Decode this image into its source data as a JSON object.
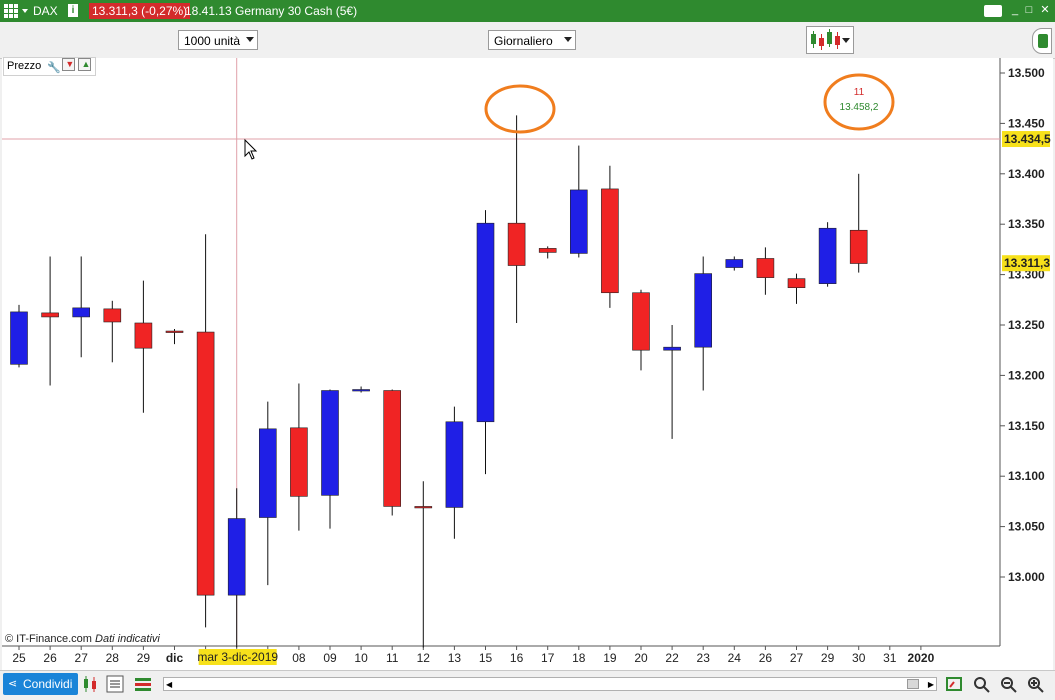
{
  "titlebar": {
    "instrument": "DAX",
    "price_badge": "13.311,3 (-0,27%)",
    "time_and_name": "18.41.13 Germany 30 Cash (5€)",
    "info_icon": "info-icon",
    "window_buttons": [
      "minimize-icon",
      "maximize-icon",
      "close-icon"
    ]
  },
  "toolbar": {
    "units_select": "1000 unità",
    "period_select": "Giornaliero"
  },
  "panel": {
    "label": "Prezzo"
  },
  "footer": {
    "credit": "© IT-Finance.com",
    "credit_italic": "Dati indicativi",
    "share_label": "Condividi"
  },
  "annotations": {
    "circle_top": "11",
    "circle_value": "13.458,2"
  },
  "crosshair": {
    "price_tag": "13.434,5",
    "date_tag": "mar 3-dic-2019"
  },
  "colors": {
    "up": "#1f1fe6",
    "down": "#f02424",
    "titlebar": "#2f8a2f",
    "annotation": "#f07d1e",
    "crosshair": "#e0a0a8",
    "last_price_tag": "#f7e11b"
  },
  "chart_data": {
    "type": "candlestick",
    "y_ticks": [
      "13.500",
      "13.450",
      "13.400",
      "13.350",
      "13.300",
      "13.250",
      "13.200",
      "13.150",
      "13.100",
      "13.050",
      "13.000"
    ],
    "ylim": [
      12.935,
      13.545
    ],
    "last_price": "13.311,3",
    "x_labels": [
      "25",
      "26",
      "27",
      "28",
      "29",
      "dic",
      "",
      "05",
      "06",
      "08",
      "09",
      "10",
      "11",
      "12",
      "13",
      "15",
      "16",
      "17",
      "18",
      "19",
      "20",
      "22",
      "23",
      "24",
      "26",
      "27",
      "29",
      "30",
      "31",
      "2020"
    ],
    "candles": [
      {
        "o": 13.211,
        "h": 13.27,
        "l": 13.208,
        "c": 13.263
      },
      {
        "o": 13.262,
        "h": 13.318,
        "l": 13.19,
        "c": 13.258
      },
      {
        "o": 13.258,
        "h": 13.318,
        "l": 13.218,
        "c": 13.267
      },
      {
        "o": 13.266,
        "h": 13.274,
        "l": 13.213,
        "c": 13.253
      },
      {
        "o": 13.252,
        "h": 13.294,
        "l": 13.163,
        "c": 13.227
      },
      {
        "o": 13.244,
        "h": 13.246,
        "l": 13.231,
        "c": 13.243
      },
      {
        "o": 13.243,
        "h": 13.34,
        "l": 12.95,
        "c": 12.982
      },
      {
        "o": 12.982,
        "h": 13.088,
        "l": 12.93,
        "c": 13.058
      },
      {
        "o": 13.059,
        "h": 13.174,
        "l": 12.992,
        "c": 13.147
      },
      {
        "o": 13.148,
        "h": 13.192,
        "l": 13.046,
        "c": 13.08
      },
      {
        "o": 13.081,
        "h": 13.186,
        "l": 13.048,
        "c": 13.185
      },
      {
        "o": 13.186,
        "h": 13.189,
        "l": 13.183,
        "c": 13.186
      },
      {
        "o": 13.185,
        "h": 13.186,
        "l": 13.061,
        "c": 13.07
      },
      {
        "o": 13.07,
        "h": 13.095,
        "l": 12.93,
        "c": 13.069
      },
      {
        "o": 13.069,
        "h": 13.169,
        "l": 13.038,
        "c": 13.154
      },
      {
        "o": 13.154,
        "h": 13.364,
        "l": 13.102,
        "c": 13.351
      },
      {
        "o": 13.351,
        "h": 13.458,
        "l": 13.252,
        "c": 13.309
      },
      {
        "o": 13.326,
        "h": 13.328,
        "l": 13.316,
        "c": 13.322
      },
      {
        "o": 13.321,
        "h": 13.428,
        "l": 13.317,
        "c": 13.384
      },
      {
        "o": 13.385,
        "h": 13.408,
        "l": 13.267,
        "c": 13.282
      },
      {
        "o": 13.282,
        "h": 13.285,
        "l": 13.205,
        "c": 13.225
      },
      {
        "o": 13.225,
        "h": 13.25,
        "l": 13.137,
        "c": 13.228
      },
      {
        "o": 13.228,
        "h": 13.318,
        "l": 13.185,
        "c": 13.301
      },
      {
        "o": 13.307,
        "h": 13.318,
        "l": 13.304,
        "c": 13.315
      },
      {
        "o": 13.316,
        "h": 13.327,
        "l": 13.28,
        "c": 13.297
      },
      {
        "o": 13.296,
        "h": 13.301,
        "l": 13.271,
        "c": 13.287
      },
      {
        "o": 13.291,
        "h": 13.352,
        "l": 13.288,
        "c": 13.346
      },
      {
        "o": 13.344,
        "h": 13.4,
        "l": 13.302,
        "c": 13.311
      }
    ]
  }
}
